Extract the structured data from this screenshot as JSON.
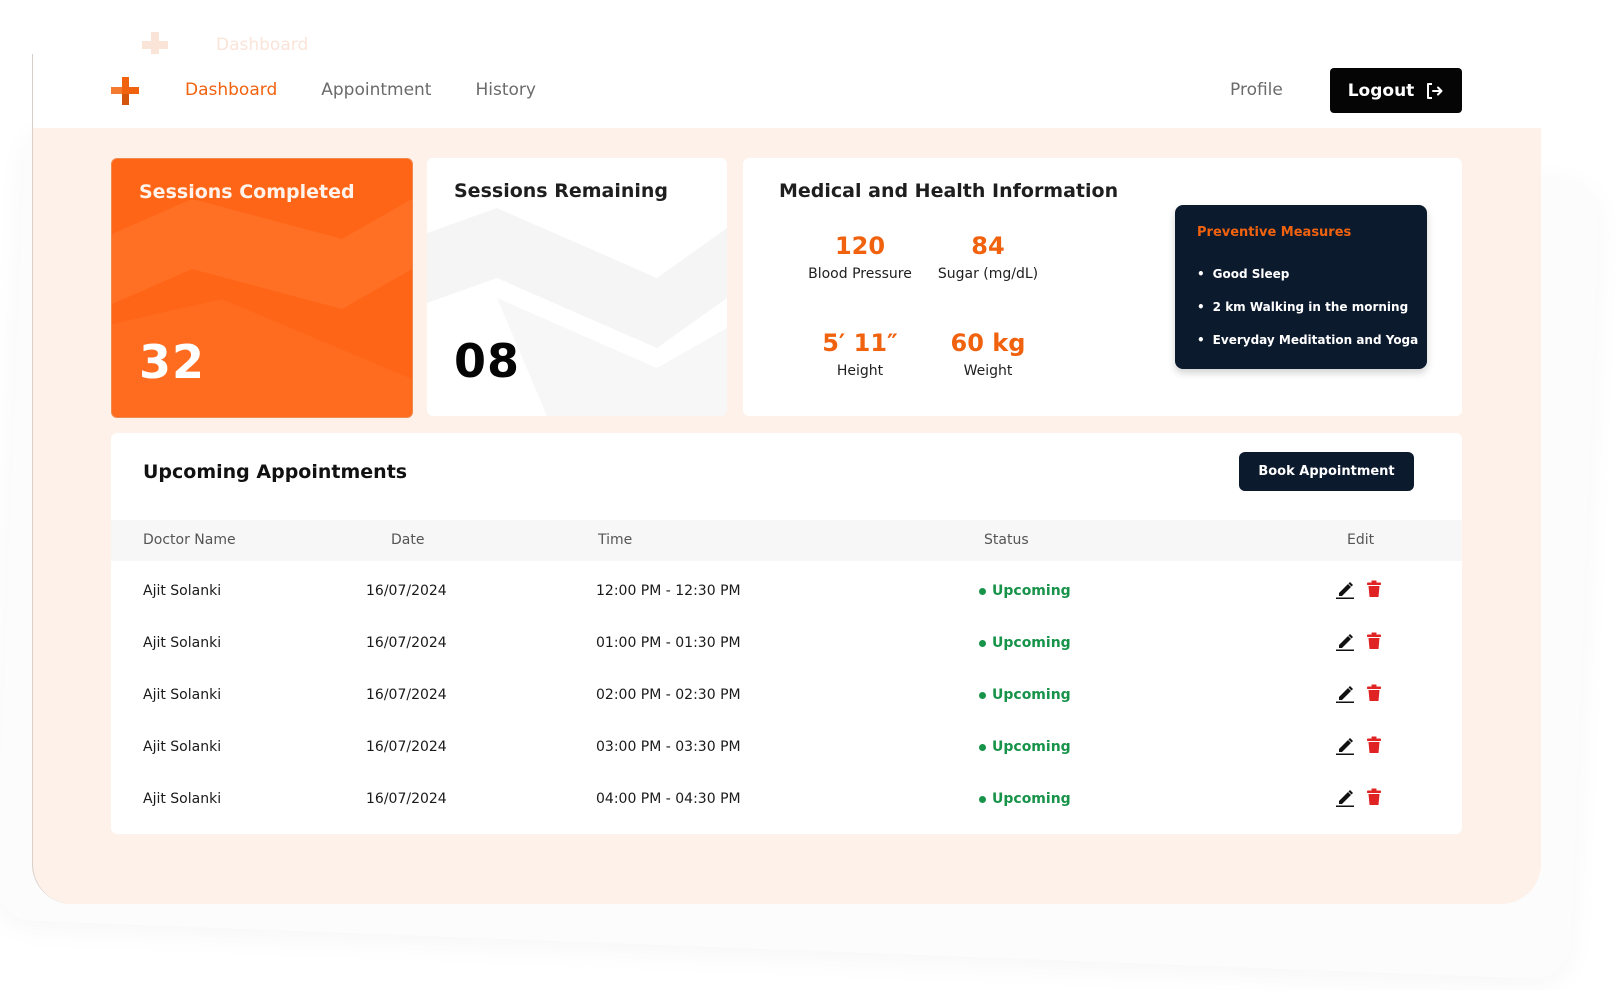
{
  "ghost": {
    "text": "Dashboard"
  },
  "nav": {
    "items": [
      {
        "label": "Dashboard",
        "active": true
      },
      {
        "label": "Appointment",
        "active": false
      },
      {
        "label": "History",
        "active": false
      }
    ],
    "profile": "Profile",
    "logout": "Logout"
  },
  "sessions": {
    "completed_label": "Sessions Completed",
    "completed_value": "32",
    "remaining_label": "Sessions Remaining",
    "remaining_value": "08"
  },
  "medical": {
    "title": "Medical and Health Information",
    "metrics": [
      {
        "value": "120",
        "label": "Blood Pressure"
      },
      {
        "value": "84",
        "label": "Sugar (mg/dL)"
      },
      {
        "value": "5′ 11″",
        "label": "Height"
      },
      {
        "value": "60 kg",
        "label": "Weight"
      }
    ],
    "preventive": {
      "title": "Preventive Measures",
      "items": [
        "Good Sleep",
        "2 km Walking in the morning",
        "Everyday Meditation and Yoga"
      ]
    }
  },
  "appointments": {
    "title": "Upcoming Appointments",
    "book_label": "Book Appointment",
    "columns": [
      "Doctor Name",
      "Date",
      "Time",
      "Status",
      "Edit"
    ],
    "rows": [
      {
        "doctor": "Ajit Solanki",
        "date": "16/07/2024",
        "time": "12:00 PM - 12:30 PM",
        "status": "Upcoming"
      },
      {
        "doctor": "Ajit Solanki",
        "date": "16/07/2024",
        "time": "01:00 PM - 01:30 PM",
        "status": "Upcoming"
      },
      {
        "doctor": "Ajit Solanki",
        "date": "16/07/2024",
        "time": "02:00 PM - 02:30 PM",
        "status": "Upcoming"
      },
      {
        "doctor": "Ajit Solanki",
        "date": "16/07/2024",
        "time": "03:00 PM - 03:30 PM",
        "status": "Upcoming"
      },
      {
        "doctor": "Ajit Solanki",
        "date": "16/07/2024",
        "time": "04:00 PM - 04:30 PM",
        "status": "Upcoming"
      }
    ]
  },
  "colors": {
    "accent": "#f1620f",
    "card_orange": "#ff6516",
    "navy": "#0c1a2e",
    "status_green": "#17934a",
    "delete_red": "#e02424"
  },
  "icons": {
    "logo": "cross-logo-icon",
    "logout": "logout-icon",
    "edit": "pencil-icon",
    "delete": "trash-icon"
  }
}
